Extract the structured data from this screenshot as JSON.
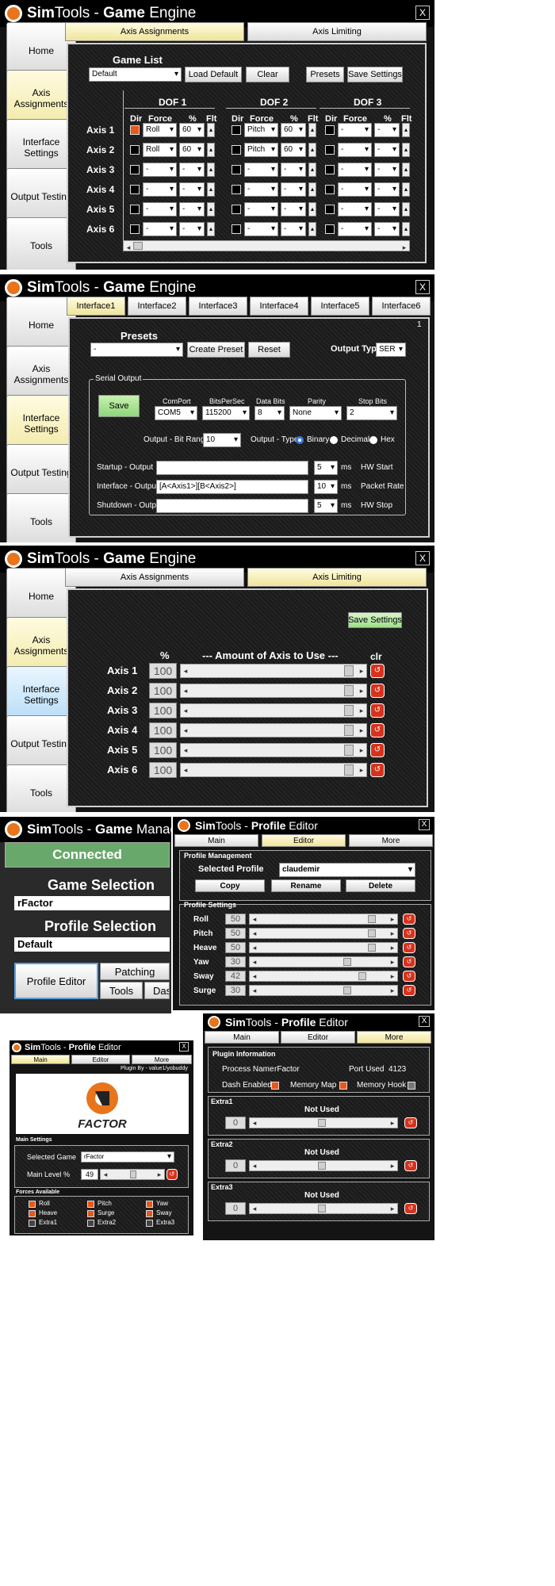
{
  "brand": {
    "sim": "Sim",
    "tools": "Tools - ",
    "game": "Game",
    "engine": " Engine",
    "manager": " Manager",
    "profile": "Profile",
    "editor": " Editor"
  },
  "nav": {
    "home": "Home",
    "axis": "Axis Assignments",
    "interface": "Interface Settings",
    "output": "Output Testing",
    "tools": "Tools"
  },
  "close": "X",
  "s1": {
    "tab1": "Axis Assignments",
    "tab2": "Axis Limiting",
    "game_list": "Game List",
    "game_sel": "Default",
    "load_default": "Load Default",
    "clear": "Clear",
    "presets": "Presets",
    "save": "Save Settings",
    "dof": [
      "DOF 1",
      "DOF 2",
      "DOF 3"
    ],
    "dir": "Dir",
    "force": "Force",
    "pct": "%",
    "flt": "Flt",
    "axes": [
      "Axis 1",
      "Axis 2",
      "Axis 3",
      "Axis 4",
      "Axis 5",
      "Axis 6"
    ],
    "rows": [
      {
        "d1": "Roll",
        "p1": "60",
        "d2": "Pitch",
        "p2": "60",
        "d3": "-",
        "p3": "-"
      },
      {
        "d1": "Roll",
        "p1": "60",
        "d2": "Pitch",
        "p2": "60",
        "d3": "-",
        "p3": "-"
      },
      {
        "d1": "-",
        "p1": "-",
        "d2": "-",
        "p2": "-",
        "d3": "-",
        "p3": "-"
      },
      {
        "d1": "-",
        "p1": "-",
        "d2": "-",
        "p2": "-",
        "d3": "-",
        "p3": "-"
      },
      {
        "d1": "-",
        "p1": "-",
        "d2": "-",
        "p2": "-",
        "d3": "-",
        "p3": "-"
      },
      {
        "d1": "-",
        "p1": "-",
        "d2": "-",
        "p2": "-",
        "d3": "-",
        "p3": "-"
      }
    ]
  },
  "s2": {
    "tabs": [
      "Interface1",
      "Interface2",
      "Interface3",
      "Interface4",
      "Interface5",
      "Interface6"
    ],
    "page_no": "1",
    "presets": "Presets",
    "preset_sel": "-",
    "create": "Create Preset",
    "reset": "Reset",
    "output_type": "Output Type",
    "output_type_val": "SER",
    "serial": "Serial Output",
    "save": "Save",
    "comport": "ComPort",
    "comport_val": "COM5",
    "bps": "BitsPerSec",
    "bps_val": "115200",
    "databits": "Data Bits",
    "databits_val": "8",
    "parity": "Parity",
    "parity_val": "None",
    "stopbits": "Stop Bits",
    "stopbits_val": "2",
    "bitrange": "Output - Bit Range",
    "bitrange_val": "10",
    "otype": "Output - Type",
    "binary": "Binary",
    "decimal": "Decimal",
    "hex": "Hex",
    "startup": "Startup - Output",
    "startup_val": "",
    "startup_ms": "5",
    "hwstart": "HW Start",
    "iface": "Interface - Output",
    "iface_val": "[A<Axis1>][B<Axis2>]",
    "iface_ms": "10",
    "packet": "Packet Rate",
    "shutdown": "Shutdown - Output",
    "shutdown_val": "",
    "shutdown_ms": "5",
    "hwstop": "HW Stop",
    "ms": "ms"
  },
  "s3": {
    "save": "Save Settings",
    "pct": "%",
    "amount": "---     Amount of Axis to Use     ---",
    "clr": "clr",
    "rows": [
      {
        "label": "Axis 1",
        "value": "100"
      },
      {
        "label": "Axis 2",
        "value": "100"
      },
      {
        "label": "Axis 3",
        "value": "100"
      },
      {
        "label": "Axis 4",
        "value": "100"
      },
      {
        "label": "Axis 5",
        "value": "100"
      },
      {
        "label": "Axis 6",
        "value": "100"
      }
    ]
  },
  "s4": {
    "status": "Connected",
    "game_sel_title": "Game Selection",
    "game": "rFactor",
    "profile_sel_title": "Profile Selection",
    "profile": "Default",
    "profile_editor": "Profile Editor",
    "patching": "Patching",
    "tools": "Tools",
    "das": "Das"
  },
  "s5": {
    "tabs": [
      "Main",
      "Editor",
      "More"
    ],
    "mgmt": "Profile Management",
    "sel_profile": "Selected Profile",
    "profile_val": "claudemir",
    "copy": "Copy",
    "rename": "Rename",
    "delete": "Delete",
    "settings": "Profile Settings",
    "rows": [
      {
        "label": "Roll",
        "value": "50",
        "level": 0.9
      },
      {
        "label": "Pitch",
        "value": "50",
        "level": 0.9
      },
      {
        "label": "Heave",
        "value": "50",
        "level": 0.9
      },
      {
        "label": "Yaw",
        "value": "30",
        "level": 0.7
      },
      {
        "label": "Sway",
        "value": "42",
        "level": 0.82
      },
      {
        "label": "Surge",
        "value": "30",
        "level": 0.7
      }
    ]
  },
  "s6": {
    "tabs": [
      "Main",
      "Editor",
      "More"
    ],
    "plugin_by": "Plugin By - value1/yobuddy",
    "logo": "FACTOR",
    "main_settings": "Main Settings",
    "selected_game": "Selected Game",
    "game_val": "rFactor",
    "main_level": "Main Level %",
    "level_val": "49",
    "level": 0.49,
    "forces_title": "Forces Available",
    "forces": [
      "Roll",
      "Pitch",
      "Yaw",
      "Heave",
      "Surge",
      "Sway",
      "Extra1",
      "Extra2",
      "Extra3"
    ],
    "forces_on": [
      true,
      true,
      true,
      true,
      true,
      true,
      false,
      false,
      false
    ]
  },
  "s7": {
    "tabs": [
      "Main",
      "Editor",
      "More"
    ],
    "plugin_info": "Plugin Information",
    "process_name": "Process Name",
    "process_val": "rFactor",
    "port_used": "Port Used",
    "port_val": "4123",
    "dash": "Dash Enabled",
    "memmap": "Memory Map",
    "memhook": "Memory Hook",
    "extras": [
      {
        "label": "Extra1",
        "status": "Not Used",
        "value": "0"
      },
      {
        "label": "Extra2",
        "status": "Not Used",
        "value": "0"
      },
      {
        "label": "Extra3",
        "status": "Not Used",
        "value": "0"
      }
    ]
  },
  "colors": {
    "orange": "#e8571c",
    "clr_red": "#d8321c",
    "connected_green": "#69a86b",
    "selected_tab": "#f2eaa8"
  }
}
